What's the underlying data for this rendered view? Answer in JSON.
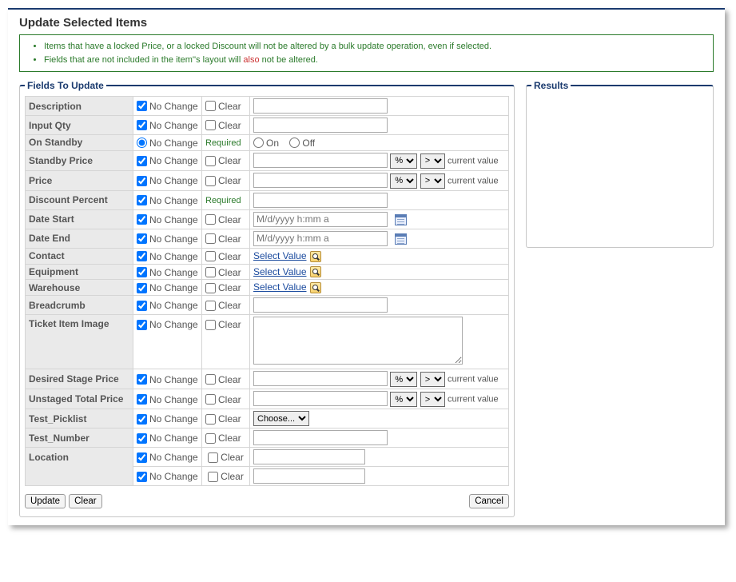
{
  "title": "Update Selected Items",
  "notice": {
    "line1": "Items that have a locked Price, or a locked Discount will not be altered by a bulk update operation, even if selected.",
    "line2a": "Fields that are not included in the item''s layout will ",
    "line2b": "also",
    "line2c": " not be altered."
  },
  "legends": {
    "fields": "Fields To Update",
    "results": "Results"
  },
  "common": {
    "no_change": "No Change",
    "clear": "Clear",
    "required": "Required",
    "current_value": "current value",
    "select_value": "Select Value",
    "choose": "Choose...",
    "date_placeholder": "M/d/yyyy h:mm a",
    "on": "On",
    "off": "Off",
    "pct": "%",
    "gt": ">"
  },
  "rows": {
    "description": {
      "label": "Description"
    },
    "input_qty": {
      "label": "Input Qty"
    },
    "on_standby": {
      "label": "On Standby"
    },
    "standby_price": {
      "label": "Standby Price"
    },
    "price": {
      "label": "Price"
    },
    "discount_percent": {
      "label": "Discount Percent"
    },
    "date_start": {
      "label": "Date Start"
    },
    "date_end": {
      "label": "Date End"
    },
    "contact": {
      "label": "Contact"
    },
    "equipment": {
      "label": "Equipment"
    },
    "warehouse": {
      "label": "Warehouse"
    },
    "breadcrumb": {
      "label": "Breadcrumb"
    },
    "ticket_image": {
      "label": "Ticket Item Image"
    },
    "desired_stage_price": {
      "label": "Desired Stage Price"
    },
    "unstaged_total_price": {
      "label": "Unstaged Total Price"
    },
    "test_picklist": {
      "label": "Test_Picklist"
    },
    "test_number": {
      "label": "Test_Number"
    },
    "location": {
      "label": "Location"
    }
  },
  "buttons": {
    "update": "Update",
    "clear": "Clear",
    "cancel": "Cancel"
  }
}
